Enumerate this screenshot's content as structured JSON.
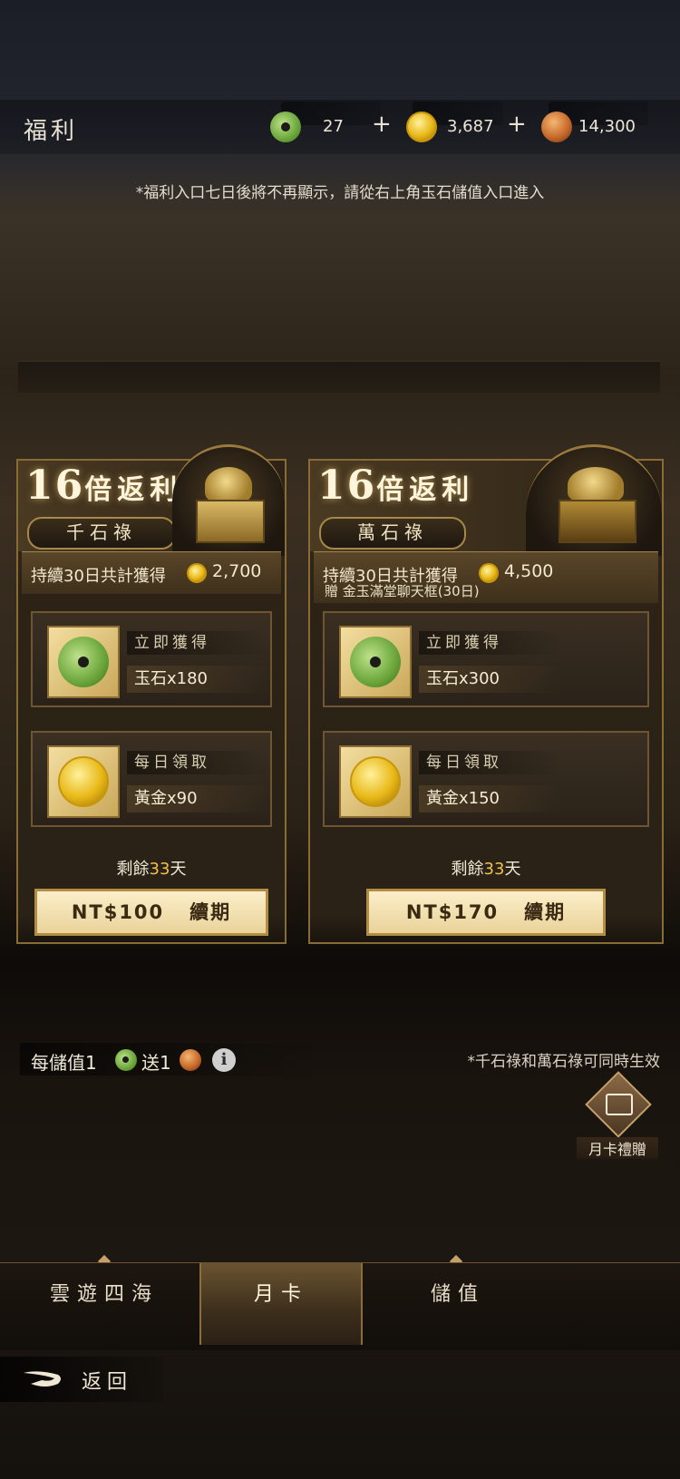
{
  "header": {
    "title": "福利",
    "jade_count": "27",
    "gold_count": "3,687",
    "seal_count": "14,300",
    "plus_label": "+"
  },
  "notice": "*福利入口七日後將不再顯示，請從右上角玉石儲值入口進入",
  "cards": [
    {
      "multiplier": "16",
      "multiplier_suffix": "倍返利",
      "plan_name": "千石祿",
      "total_text": "持續30日共計獲得",
      "total_amount": "2,700",
      "bonus": "",
      "instant_label": "立即獲得",
      "instant_item": "玉石x180",
      "daily_label": "每日領取",
      "daily_item": "黃金x90",
      "remain_prefix": "剩餘",
      "remain_days": "33",
      "remain_suffix": "天",
      "price": "NT$100",
      "renew": "續期"
    },
    {
      "multiplier": "16",
      "multiplier_suffix": "倍返利",
      "plan_name": "萬石祿",
      "total_text": "持續30日共計獲得",
      "total_amount": "4,500",
      "bonus": "贈 金玉滿堂聊天框(30日)",
      "instant_label": "立即獲得",
      "instant_item": "玉石x300",
      "daily_label": "每日領取",
      "daily_item": "黃金x150",
      "remain_prefix": "剩餘",
      "remain_days": "33",
      "remain_suffix": "天",
      "price": "NT$170",
      "renew": "續期"
    }
  ],
  "promo": {
    "part1": "每儲值1",
    "part2": "送1"
  },
  "note": "*千石祿和萬石祿可同時生效",
  "gift_label": "月卡禮贈",
  "tabs": [
    "雲遊四海",
    "月卡",
    "儲值"
  ],
  "active_tab": "月卡",
  "back_label": "返回",
  "colors": {
    "accent_gold": "#f1c24b",
    "button_bg": "#fbeec9",
    "border_gold": "#b28d43"
  },
  "icons": [
    "jade-icon",
    "gold-coin-icon",
    "seal-coin-icon",
    "info-icon",
    "gift-box-icon",
    "back-arrow-icon"
  ]
}
